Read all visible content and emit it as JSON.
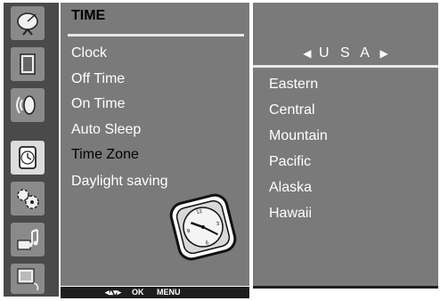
{
  "menu": {
    "title": "TIME",
    "items": [
      {
        "label": "Clock",
        "selected": false
      },
      {
        "label": "Off Time",
        "selected": false
      },
      {
        "label": "On Time",
        "selected": false
      },
      {
        "label": "Auto Sleep",
        "selected": false
      },
      {
        "label": "Time Zone",
        "selected": true
      },
      {
        "label": "Daylight saving",
        "selected": false
      }
    ]
  },
  "sidebar": {
    "icons": [
      "satellite-dish-icon",
      "screen-icon",
      "speaker-icon",
      "clock-icon",
      "gears-icon",
      "music-notes-icon",
      "pc-monitor-icon"
    ],
    "active_index": 3
  },
  "hints": {
    "nav_symbol": "◂▴▾▸",
    "ok_label": "OK",
    "menu_label": "MENU"
  },
  "panel": {
    "left_arrow": "◀",
    "country": "U S A",
    "right_arrow": "▶",
    "zones": [
      "Eastern",
      "Central",
      "Mountain",
      "Pacific",
      "Alaska",
      "Hawaii"
    ]
  },
  "colors": {
    "sidebar_bg": "#4a4a4a",
    "menu_bg": "#7a7a7a",
    "selected_text": "#000000",
    "normal_text": "#ffffff"
  }
}
